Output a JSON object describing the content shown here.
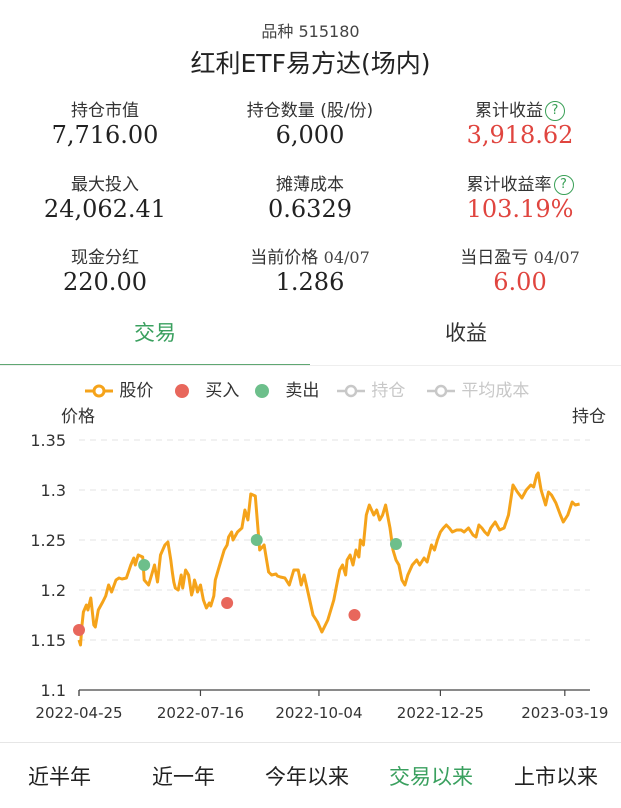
{
  "fund": {
    "code_line": "品种 515180",
    "name": "红利ETF易方达(场内)"
  },
  "stats": {
    "market_value": {
      "label": "持仓市值",
      "value": "7,716.00"
    },
    "quantity": {
      "label": "持仓数量 (股/份)",
      "value": "6,000"
    },
    "cum_return": {
      "label": "累计收益",
      "value": "3,918.62"
    },
    "max_invest": {
      "label": "最大投入",
      "value": "24,062.41"
    },
    "diluted_cost": {
      "label": "摊薄成本",
      "value": "0.6329"
    },
    "cum_return_rate": {
      "label": "累计收益率",
      "value": "103.19%"
    },
    "cash_dividend": {
      "label": "现金分红",
      "value": "220.00"
    },
    "current_price": {
      "label": "当前价格",
      "date": "04/07",
      "value": "1.286"
    },
    "daily_pnl": {
      "label": "当日盈亏",
      "date": "04/07",
      "value": "6.00"
    },
    "help_glyph": "?"
  },
  "tabs": {
    "trade": "交易",
    "return": "收益"
  },
  "legend": {
    "price": "股价",
    "buy": "买入",
    "sell": "卖出",
    "holding": "持仓",
    "avg_cost": "平均成本"
  },
  "colors": {
    "price_line": "#f5a31a",
    "buy": "#e8675c",
    "sell": "#6dbf8b",
    "accent": "#3aa05f",
    "negative": "#e0453f",
    "disabled": "#c8c8c8"
  },
  "chart_data": {
    "type": "line",
    "ylabel": "价格",
    "y2label": "持仓",
    "ylim": [
      1.1,
      1.35
    ],
    "y_ticks": [
      1.1,
      1.15,
      1.2,
      1.25,
      1.3,
      1.35
    ],
    "x_tick_labels": [
      "2022-04-25",
      "2022-07-16",
      "2022-10-04",
      "2022-12-25",
      "2023-03-19"
    ],
    "x_tick_days": [
      0,
      82,
      162,
      244,
      328
    ],
    "grid": true,
    "series": [
      {
        "name": "股价",
        "x_days": [
          0,
          1,
          2,
          3,
          5,
          6,
          8,
          10,
          11,
          13,
          16,
          18,
          20,
          22,
          25,
          27,
          29,
          32,
          35,
          37,
          38,
          40,
          43,
          44,
          47,
          49,
          51,
          53,
          55,
          58,
          60,
          62,
          63,
          64,
          65,
          67,
          69,
          70,
          72,
          74,
          76,
          77,
          78,
          79,
          80,
          82,
          84,
          86,
          88,
          89,
          91,
          92,
          94,
          96,
          98,
          100,
          101,
          103,
          104,
          107,
          110,
          112,
          114,
          116,
          119,
          122,
          125,
          128,
          130,
          133,
          134,
          136,
          139,
          142,
          145,
          148,
          150,
          152,
          155,
          158,
          161,
          164,
          168,
          172,
          174,
          176,
          178,
          180,
          181,
          183,
          185,
          187,
          189,
          190,
          192,
          194,
          196,
          199,
          201,
          203,
          205,
          207,
          210,
          212,
          214,
          216,
          218,
          220,
          222,
          225,
          228,
          230,
          233,
          235,
          238,
          240,
          242,
          244,
          246,
          248,
          250,
          252,
          255,
          258,
          260,
          263,
          266,
          268,
          270,
          272,
          274,
          276,
          278,
          281,
          284,
          287,
          290,
          293,
          296,
          299,
          302,
          305,
          307,
          309,
          310,
          312,
          314,
          315,
          317,
          319,
          322,
          325,
          327,
          330,
          333,
          335,
          338,
          340,
          342,
          344,
          345
        ],
        "values": [
          1.15,
          1.145,
          1.165,
          1.178,
          1.185,
          1.18,
          1.192,
          1.165,
          1.163,
          1.18,
          1.188,
          1.194,
          1.205,
          1.198,
          1.21,
          1.212,
          1.211,
          1.212,
          1.225,
          1.232,
          1.225,
          1.235,
          1.233,
          1.21,
          1.205,
          1.215,
          1.225,
          1.208,
          1.235,
          1.245,
          1.248,
          1.23,
          1.218,
          1.208,
          1.202,
          1.2,
          1.215,
          1.202,
          1.22,
          1.215,
          1.195,
          1.2,
          1.21,
          1.205,
          1.198,
          1.205,
          1.19,
          1.182,
          1.187,
          1.184,
          1.194,
          1.21,
          1.22,
          1.23,
          1.24,
          1.245,
          1.253,
          1.258,
          1.25,
          1.258,
          1.262,
          1.28,
          1.27,
          1.296,
          1.294,
          1.24,
          1.245,
          1.218,
          1.215,
          1.216,
          1.214,
          1.213,
          1.212,
          1.205,
          1.22,
          1.22,
          1.205,
          1.215,
          1.195,
          1.175,
          1.168,
          1.158,
          1.17,
          1.19,
          1.205,
          1.22,
          1.225,
          1.215,
          1.23,
          1.235,
          1.225,
          1.24,
          1.233,
          1.25,
          1.245,
          1.275,
          1.285,
          1.275,
          1.28,
          1.27,
          1.275,
          1.285,
          1.262,
          1.24,
          1.23,
          1.225,
          1.21,
          1.205,
          1.215,
          1.225,
          1.23,
          1.225,
          1.232,
          1.228,
          1.245,
          1.24,
          1.25,
          1.258,
          1.262,
          1.265,
          1.262,
          1.258,
          1.26,
          1.26,
          1.258,
          1.262,
          1.255,
          1.253,
          1.265,
          1.262,
          1.258,
          1.255,
          1.262,
          1.268,
          1.26,
          1.262,
          1.275,
          1.305,
          1.298,
          1.292,
          1.3,
          1.305,
          1.303,
          1.315,
          1.317,
          1.3,
          1.29,
          1.285,
          1.298,
          1.295,
          1.287,
          1.275,
          1.268,
          1.275,
          1.288,
          1.285,
          1.286
        ]
      }
    ],
    "buy_points": [
      {
        "x_days": 0,
        "y": 1.16
      },
      {
        "x_days": 100,
        "y": 1.187
      },
      {
        "x_days": 186,
        "y": 1.175
      }
    ],
    "sell_points": [
      {
        "x_days": 44,
        "y": 1.225
      },
      {
        "x_days": 120,
        "y": 1.25
      },
      {
        "x_days": 214,
        "y": 1.246
      }
    ]
  },
  "periods": {
    "half_year": "近半年",
    "one_year": "近一年",
    "ytd": "今年以来",
    "since_trade": "交易以来",
    "since_listing": "上市以来"
  }
}
